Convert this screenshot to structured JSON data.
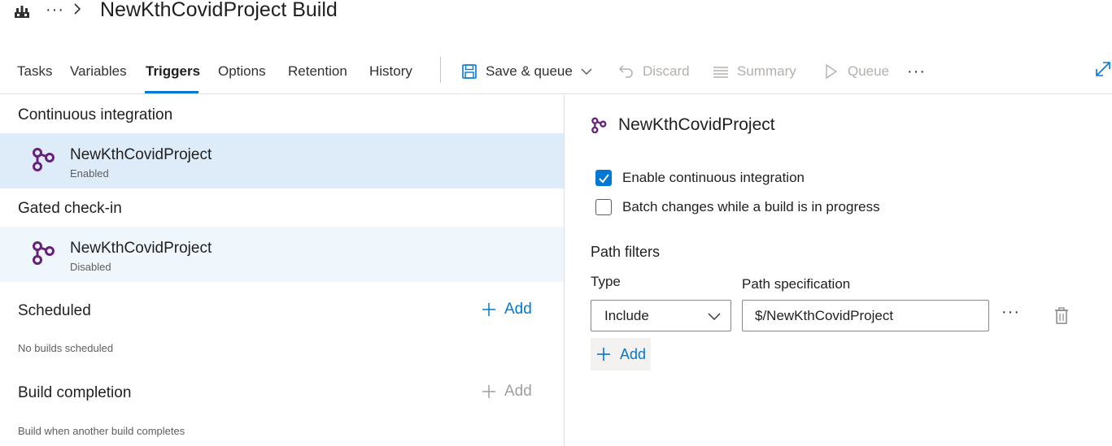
{
  "header": {
    "breadcrumb_more": "···",
    "title": "NewKthCovidProject Build"
  },
  "tabs": [
    {
      "label": "Tasks",
      "active": false
    },
    {
      "label": "Variables",
      "active": false
    },
    {
      "label": "Triggers",
      "active": true
    },
    {
      "label": "Options",
      "active": false
    },
    {
      "label": "Retention",
      "active": false
    },
    {
      "label": "History",
      "active": false
    }
  ],
  "toolbar": {
    "save_queue_label": "Save & queue",
    "discard_label": "Discard",
    "summary_label": "Summary",
    "queue_label": "Queue",
    "more_label": "···"
  },
  "left": {
    "continuous_integration": {
      "title": "Continuous integration",
      "item": {
        "name": "NewKthCovidProject",
        "status": "Enabled"
      }
    },
    "gated_checkin": {
      "title": "Gated check-in",
      "item": {
        "name": "NewKthCovidProject",
        "status": "Disabled"
      }
    },
    "scheduled": {
      "title": "Scheduled",
      "add_label": "Add",
      "empty_text": "No builds scheduled"
    },
    "build_completion": {
      "title": "Build completion",
      "add_label": "Add",
      "description": "Build when another build completes"
    }
  },
  "right": {
    "repo_title": "NewKthCovidProject",
    "enable_ci_label": "Enable continuous integration",
    "enable_ci_checked": true,
    "batch_label": "Batch changes while a build is in progress",
    "batch_checked": false,
    "path_filters_title": "Path filters",
    "type_label": "Type",
    "path_spec_label": "Path specification",
    "filter": {
      "type": "Include",
      "path": "$/NewKthCovidProject",
      "more_label": "···"
    },
    "add_label": "Add"
  },
  "colors": {
    "accent": "#0078d4",
    "selected_row": "#deecf9",
    "repo_icon": "#68217a",
    "disabled_text": "#b3b0ad"
  }
}
